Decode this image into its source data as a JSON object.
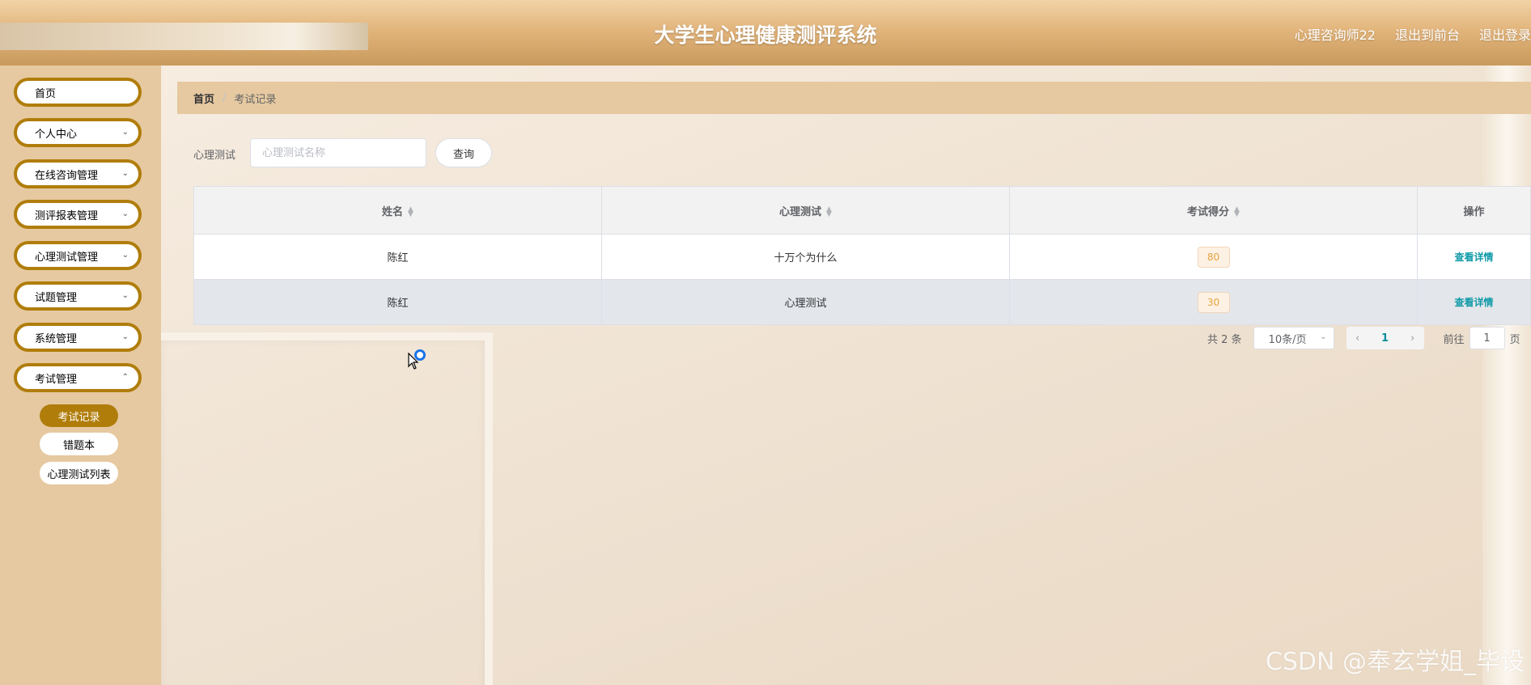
{
  "header": {
    "title": "大学生心理健康测评系统",
    "user": "心理咨询师22",
    "front_link": "退出到前台",
    "logout_link": "退出登录"
  },
  "sidebar": {
    "items": [
      {
        "label": "首页"
      },
      {
        "label": "个人中心"
      },
      {
        "label": "在线咨询管理"
      },
      {
        "label": "测评报表管理"
      },
      {
        "label": "心理测试管理"
      },
      {
        "label": "试题管理"
      },
      {
        "label": "系统管理"
      },
      {
        "label": "考试管理"
      }
    ],
    "sub_items": [
      {
        "label": "考试记录",
        "active": true
      },
      {
        "label": "错题本"
      },
      {
        "label": "心理测试列表"
      }
    ]
  },
  "breadcrumb": {
    "home": "首页",
    "separator": "/",
    "current": "考试记录"
  },
  "search": {
    "label": "心理测试",
    "placeholder": "心理测试名称",
    "button": "查询"
  },
  "table": {
    "columns": [
      "姓名",
      "心理测试",
      "考试得分",
      "操作"
    ],
    "rows": [
      {
        "name": "陈红",
        "test": "十万个为什么",
        "score": "80",
        "action": "查看详情"
      },
      {
        "name": "陈红",
        "test": "心理测试",
        "score": "30",
        "action": "查看详情"
      }
    ]
  },
  "pagination": {
    "total": "共 2 条",
    "page_size": "10条/页",
    "current_page": "1",
    "goto_label": "前往",
    "goto_value": "1",
    "page_unit": "页"
  },
  "watermark": "CSDN @奉玄学姐_毕设",
  "colors": {
    "accent": "#b07d0b",
    "header": "#e2b57c",
    "sidebar": "#e6c9a0",
    "link": "#0f9aa8"
  }
}
